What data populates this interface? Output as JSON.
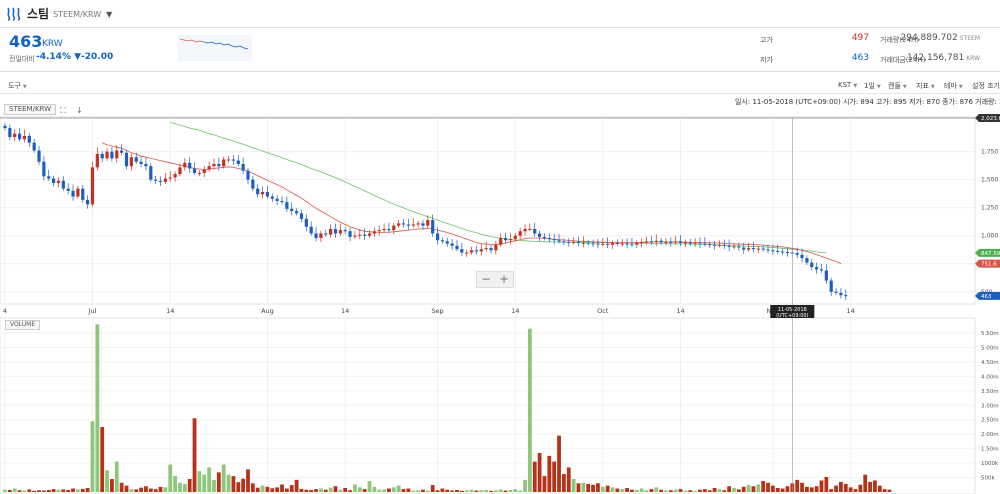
{
  "header": {
    "coin_name": "스팀",
    "pair": "STEEM/KRW",
    "caret": "▼"
  },
  "price": {
    "current": "463",
    "unit": "KRW",
    "change_label": "전일대비",
    "change_percent": "-4.14%",
    "change_amount": "▼-20.00"
  },
  "stats": {
    "high_label": "고가",
    "high_value": "497",
    "low_label": "저가",
    "low_value": "463",
    "volume_label": "거래량(24H)",
    "volume_value": "294,889.702",
    "volume_unit": "STEEM",
    "amount_label": "거래대금(24H)",
    "amount_value": "142,156,781",
    "amount_unit": "KRW"
  },
  "toolbar": {
    "tools": "도구",
    "timezone": "KST",
    "interval": "1일",
    "chart_type": "캔들",
    "indicators": "지표",
    "theme": "테마",
    "settings": "설정 조기화"
  },
  "chart": {
    "symbol": "STEEM/KRW",
    "ohlc": "일시: 11-05-2018 (UTC+09:00)  시가: 894  고가: 895  저가: 870  종가: 876  거래량: 232,650.0",
    "volume_label": "VOLUME",
    "price_ticks": [
      "1,750",
      "1,500",
      "1,250",
      "1,000",
      "750",
      "500"
    ],
    "top_price_label": "2,023.61",
    "ma_green_label": "847.59",
    "ma_red_label": "751.6",
    "last_price_label": "463",
    "x_labels": [
      {
        "t": "4",
        "i": 0
      },
      {
        "t": "Jul",
        "i": 18
      },
      {
        "t": "14",
        "i": 34
      },
      {
        "t": "Aug",
        "i": 54
      },
      {
        "t": "14",
        "i": 70
      },
      {
        "t": "Sep",
        "i": 89
      },
      {
        "t": "14",
        "i": 105
      },
      {
        "t": "Oct",
        "i": 123
      },
      {
        "t": "14",
        "i": 139
      },
      {
        "t": "Nov",
        "i": 158
      },
      {
        "t": "14",
        "i": 174
      }
    ],
    "crosshair_date": "11-05-2018",
    "crosshair_tz": "(UTC+09:00)",
    "volume_ticks": [
      "5.50m",
      "5.00m",
      "4.50m",
      "4.00m",
      "3.50m",
      "3.00m",
      "2.50m",
      "2.00m",
      "1.50m",
      "1000k",
      "500k"
    ],
    "zoom_minus": "−",
    "zoom_plus": "+",
    "colors": {
      "up": "#c8301e",
      "down": "#1d5fbe",
      "vol_up": "#8ec77c",
      "vol_down": "#b8321a",
      "ma_green": "#6cc26a",
      "ma_red": "#d9564b"
    }
  },
  "chart_data": {
    "type": "candlestick",
    "x_unit": "day",
    "ylim": [
      400,
      2050
    ],
    "close_series": [
      1960,
      1880,
      1910,
      1860,
      1890,
      1830,
      1760,
      1660,
      1530,
      1510,
      1470,
      1490,
      1420,
      1400,
      1350,
      1420,
      1320,
      1280,
      1610,
      1730,
      1690,
      1750,
      1690,
      1760,
      1740,
      1620,
      1700,
      1660,
      1640,
      1620,
      1500,
      1490,
      1480,
      1510,
      1520,
      1550,
      1610,
      1650,
      1600,
      1560,
      1560,
      1590,
      1620,
      1640,
      1620,
      1680,
      1680,
      1670,
      1640,
      1580,
      1500,
      1420,
      1370,
      1390,
      1350,
      1330,
      1310,
      1300,
      1240,
      1220,
      1200,
      1150,
      1080,
      1020,
      980,
      1020,
      1010,
      1060,
      1020,
      1050,
      1040,
      990,
      1000,
      1010,
      1000,
      1020,
      1040,
      1050,
      1060,
      1050,
      1090,
      1110,
      1100,
      1090,
      1100,
      1110,
      1090,
      1140,
      1020,
      960,
      950,
      930,
      910,
      880,
      850,
      850,
      870,
      860,
      880,
      890,
      870,
      920,
      980,
      960,
      970,
      1000,
      1040,
      1060,
      1060,
      1020,
      990,
      980,
      970,
      960,
      950,
      945,
      940,
      945,
      935,
      938,
      932,
      930,
      925,
      928,
      920,
      935,
      930,
      930,
      925,
      920,
      935,
      940,
      950,
      945,
      955,
      940,
      945,
      940,
      950,
      935,
      940,
      930,
      938,
      930,
      925,
      920,
      915,
      918,
      910,
      900,
      905,
      895,
      876,
      890,
      880,
      885,
      878,
      870,
      865,
      860,
      855,
      850,
      845,
      830,
      800,
      760,
      720,
      700,
      690,
      600,
      500,
      490,
      470,
      463
    ],
    "ma_green": [
      null,
      null,
      null,
      null,
      null,
      null,
      null,
      null,
      null,
      null,
      null,
      null,
      null,
      null,
      null,
      null,
      null,
      null,
      null,
      null,
      null,
      null,
      null,
      null,
      null,
      null,
      null,
      null,
      null,
      null,
      null,
      null,
      null,
      null,
      2010,
      2000,
      1985,
      1975,
      1960,
      1950,
      1940,
      1925,
      1910,
      1900,
      1885,
      1870,
      1860,
      1845,
      1830,
      1815,
      1800,
      1785,
      1770,
      1755,
      1740,
      1725,
      1710,
      1695,
      1680,
      1665,
      1650,
      1635,
      1618,
      1600,
      1585,
      1570,
      1552,
      1535,
      1518,
      1500,
      1480,
      1460,
      1440,
      1420,
      1400,
      1380,
      1360,
      1340,
      1320,
      1300,
      1282,
      1265,
      1248,
      1230,
      1215,
      1200,
      1185,
      1170,
      1155,
      1140,
      1125,
      1110,
      1095,
      1080,
      1065,
      1050,
      1038,
      1026,
      1014,
      1002,
      992,
      985,
      978,
      972,
      967,
      962,
      958,
      955,
      952,
      950,
      948,
      947,
      946,
      945,
      944,
      943,
      943,
      942,
      942,
      941,
      940,
      940,
      939,
      938,
      938,
      937,
      936,
      936,
      935,
      935,
      934,
      933,
      933,
      932,
      931,
      931,
      930,
      929,
      928,
      927,
      926,
      925,
      924,
      923,
      922,
      921,
      920,
      918,
      916,
      914,
      912,
      910,
      908,
      906,
      904,
      902,
      900,
      898,
      895,
      892,
      888,
      884,
      880,
      876,
      872,
      868,
      862,
      856,
      850,
      847
    ],
    "ma_red": [
      null,
      null,
      null,
      null,
      null,
      null,
      null,
      null,
      null,
      null,
      null,
      null,
      null,
      null,
      null,
      null,
      null,
      null,
      null,
      null,
      1830,
      1810,
      1800,
      1790,
      1780,
      1760,
      1740,
      1730,
      1710,
      1700,
      1690,
      1680,
      1670,
      1660,
      1650,
      1640,
      1630,
      1620,
      1610,
      1600,
      1595,
      1590,
      1595,
      1600,
      1605,
      1610,
      1615,
      1610,
      1600,
      1590,
      1575,
      1555,
      1535,
      1515,
      1495,
      1475,
      1455,
      1435,
      1410,
      1385,
      1360,
      1335,
      1305,
      1275,
      1245,
      1220,
      1195,
      1170,
      1145,
      1120,
      1100,
      1080,
      1065,
      1050,
      1040,
      1035,
      1032,
      1030,
      1030,
      1032,
      1035,
      1040,
      1045,
      1050,
      1055,
      1060,
      1062,
      1065,
      1060,
      1050,
      1040,
      1028,
      1015,
      1000,
      985,
      970,
      955,
      940,
      930,
      925,
      920,
      920,
      925,
      935,
      945,
      955,
      965,
      975,
      980,
      980,
      978,
      975,
      972,
      968,
      965,
      962,
      958,
      955,
      952,
      950,
      948,
      946,
      944,
      942,
      941,
      940,
      940,
      940,
      940,
      940,
      940,
      941,
      942,
      943,
      944,
      945,
      945,
      945,
      944,
      943,
      942,
      941,
      940,
      939,
      938,
      937,
      936,
      935,
      933,
      930,
      928,
      926,
      924,
      922,
      920,
      918,
      916,
      912,
      908,
      904,
      900,
      894,
      888,
      880,
      870,
      858,
      846,
      832,
      816,
      800,
      785,
      770,
      751.6
    ],
    "volume": [
      0.08,
      0.07,
      0.12,
      0.06,
      0.05,
      0.09,
      0.04,
      0.06,
      0.05,
      0.07,
      0.1,
      0.08,
      0.09,
      0.07,
      0.12,
      0.09,
      0.11,
      0.14,
      2.45,
      5.8,
      2.25,
      0.75,
      0.45,
      1.05,
      0.32,
      0.22,
      0.1,
      0.09,
      0.15,
      0.2,
      0.12,
      0.1,
      0.18,
      0.16,
      0.95,
      0.55,
      0.32,
      0.28,
      0.45,
      2.55,
      0.72,
      0.6,
      0.85,
      0.42,
      0.68,
      0.95,
      0.6,
      0.55,
      0.34,
      0.46,
      0.78,
      0.3,
      0.15,
      0.22,
      0.18,
      0.13,
      0.16,
      0.26,
      0.12,
      0.24,
      0.42,
      0.11,
      0.08,
      0.07,
      0.1,
      0.12,
      0.08,
      0.15,
      0.2,
      0.08,
      0.14,
      0.06,
      0.26,
      0.16,
      0.1,
      0.38,
      0.18,
      0.08,
      0.09,
      0.12,
      0.16,
      0.22,
      0.1,
      0.12,
      0.05,
      0.06,
      0.08,
      0.05,
      0.24,
      0.06,
      0.12,
      0.08,
      0.05,
      0.07,
      0.04,
      0.06,
      0.08,
      0.05,
      0.06,
      0.07,
      0.04,
      0.06,
      0.09,
      0.05,
      0.07,
      0.1,
      0.05,
      0.42,
      5.65,
      1.05,
      1.35,
      0.55,
      1.25,
      1.05,
      1.95,
      0.62,
      0.85,
      0.45,
      0.3,
      0.32,
      0.28,
      0.25,
      0.3,
      0.18,
      0.22,
      0.16,
      0.12,
      0.1,
      0.14,
      0.08,
      0.07,
      0.12,
      0.06,
      0.1,
      0.16,
      0.08,
      0.05,
      0.06,
      0.08,
      0.1,
      0.05,
      0.06,
      0.04,
      0.08,
      0.1,
      0.06,
      0.14,
      0.1,
      0.06,
      0.2,
      0.14,
      0.09,
      0.18,
      0.24,
      0.2,
      0.26,
      0.38,
      0.32,
      0.22,
      0.14,
      0.12,
      0.2,
      0.3,
      0.42,
      0.32,
      0.18,
      0.16,
      0.2,
      0.4,
      0.52,
      0.1,
      0.22,
      0.35,
      0.28,
      0.16,
      0.1,
      0.25,
      0.6,
      0.35,
      0.4,
      0.22,
      0.1,
      0.08
    ]
  }
}
